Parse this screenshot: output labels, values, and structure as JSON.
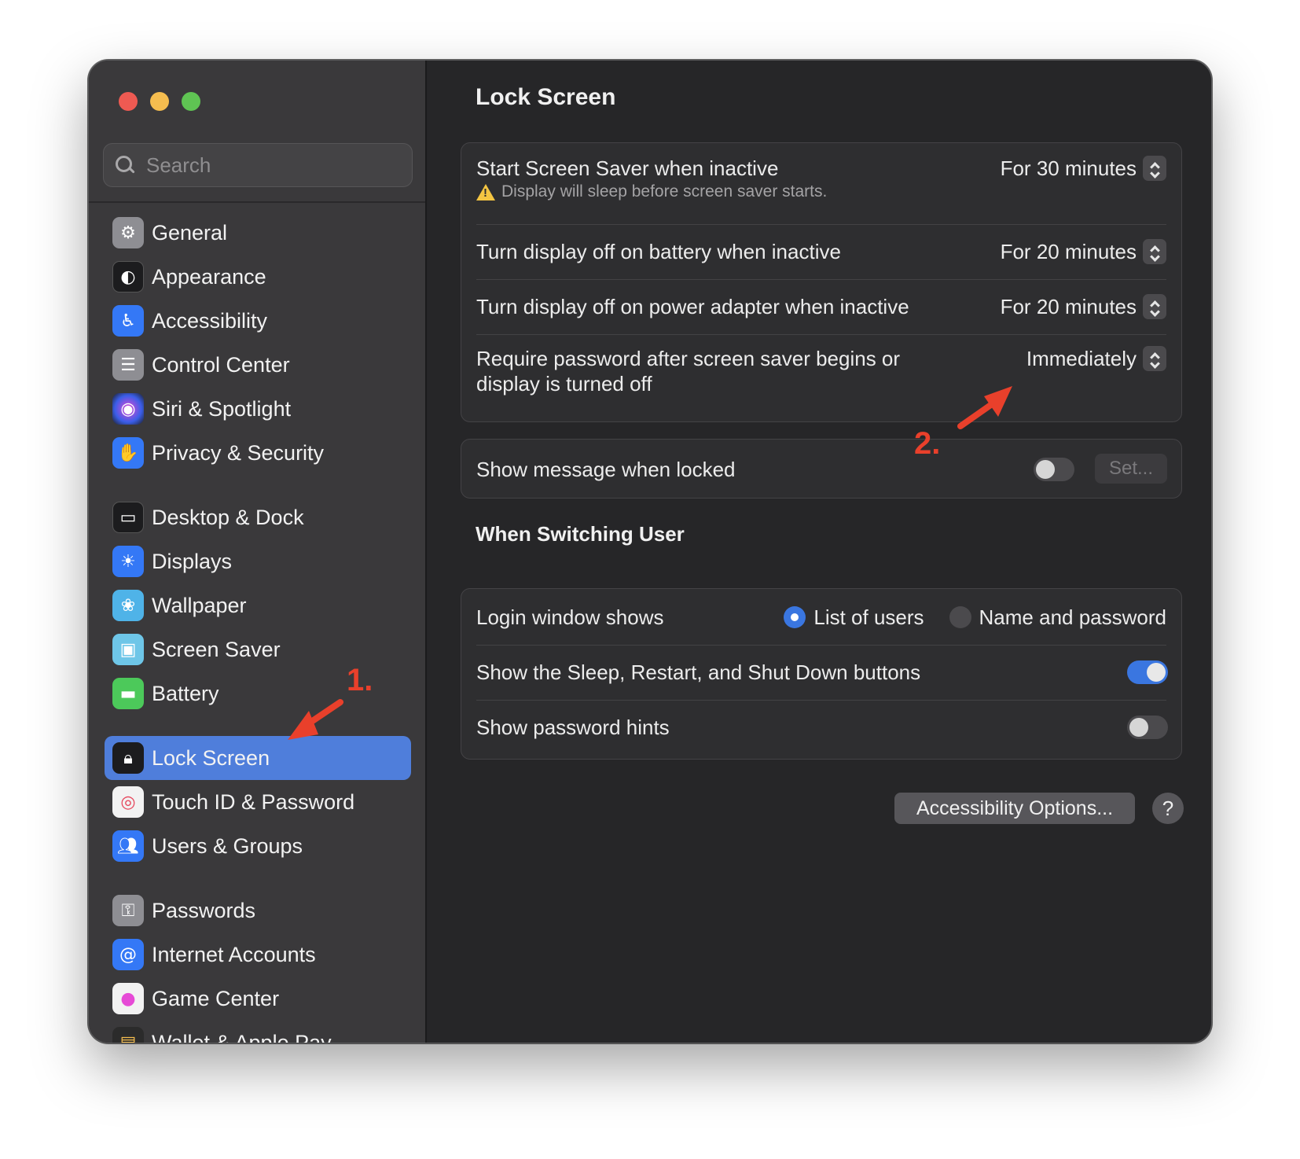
{
  "window": {
    "traffic_lights": [
      "close",
      "minimize",
      "maximize"
    ]
  },
  "sidebar": {
    "search_placeholder": "Search",
    "items": [
      {
        "label": "General",
        "icon": "gear-icon",
        "color": "#8e8e93"
      },
      {
        "label": "Appearance",
        "icon": "appearance-icon",
        "color": "#1c1c1e"
      },
      {
        "label": "Accessibility",
        "icon": "accessibility-icon",
        "color": "#3478f6"
      },
      {
        "label": "Control Center",
        "icon": "control-center-icon",
        "color": "#8e8e93"
      },
      {
        "label": "Siri & Spotlight",
        "icon": "siri-icon",
        "color": "#b43ccf"
      },
      {
        "label": "Privacy & Security",
        "icon": "hand-icon",
        "color": "#3478f6"
      },
      {
        "label": "Desktop & Dock",
        "icon": "dock-icon",
        "color": "#1c1c1e"
      },
      {
        "label": "Displays",
        "icon": "sun-icon",
        "color": "#3478f6"
      },
      {
        "label": "Wallpaper",
        "icon": "flower-icon",
        "color": "#4fb3e8"
      },
      {
        "label": "Screen Saver",
        "icon": "screen-saver-icon",
        "color": "#6ec6e8"
      },
      {
        "label": "Battery",
        "icon": "battery-icon",
        "color": "#4cc95a"
      },
      {
        "label": "Lock Screen",
        "icon": "lock-icon",
        "color": "#1c1c1e",
        "active": true
      },
      {
        "label": "Touch ID & Password",
        "icon": "fingerprint-icon",
        "color": "#f2f2f2"
      },
      {
        "label": "Users & Groups",
        "icon": "users-icon",
        "color": "#3478f6"
      },
      {
        "label": "Passwords",
        "icon": "key-icon",
        "color": "#8e8e93"
      },
      {
        "label": "Internet Accounts",
        "icon": "at-icon",
        "color": "#3478f6"
      },
      {
        "label": "Game Center",
        "icon": "game-center-icon",
        "color": "#f2f2f2"
      },
      {
        "label": "Wallet & Apple Pay",
        "icon": "wallet-icon",
        "color": "#2b2b2b"
      }
    ]
  },
  "main": {
    "title": "Lock Screen",
    "rows": [
      {
        "label": "Start Screen Saver when inactive",
        "sub": "Display will sleep before screen saver starts.",
        "value": "For 30 minutes"
      },
      {
        "label": "Turn display off on battery when inactive",
        "value": "For 20 minutes"
      },
      {
        "label": "Turn display off on power adapter when inactive",
        "value": "For 20 minutes"
      },
      {
        "label": "Require password after screen saver begins or",
        "label2": "display is turned off",
        "value": "Immediately"
      }
    ],
    "message_row": {
      "label": "Show message when locked",
      "toggle": false,
      "button": "Set..."
    },
    "switching_title": "When Switching User",
    "switching": {
      "login_label": "Login window shows",
      "option_1": "List of users",
      "option_2": "Name and password",
      "selected": "List of users",
      "sleep_label": "Show the Sleep, Restart, and Shut Down buttons",
      "sleep_toggle": true,
      "hints_label": "Show password hints",
      "hints_toggle": false
    },
    "accessibility_button": "Accessibility Options...",
    "help_button": "?"
  },
  "annotations": {
    "step1": "1.",
    "step2": "2.",
    "color": "#e9402b"
  }
}
